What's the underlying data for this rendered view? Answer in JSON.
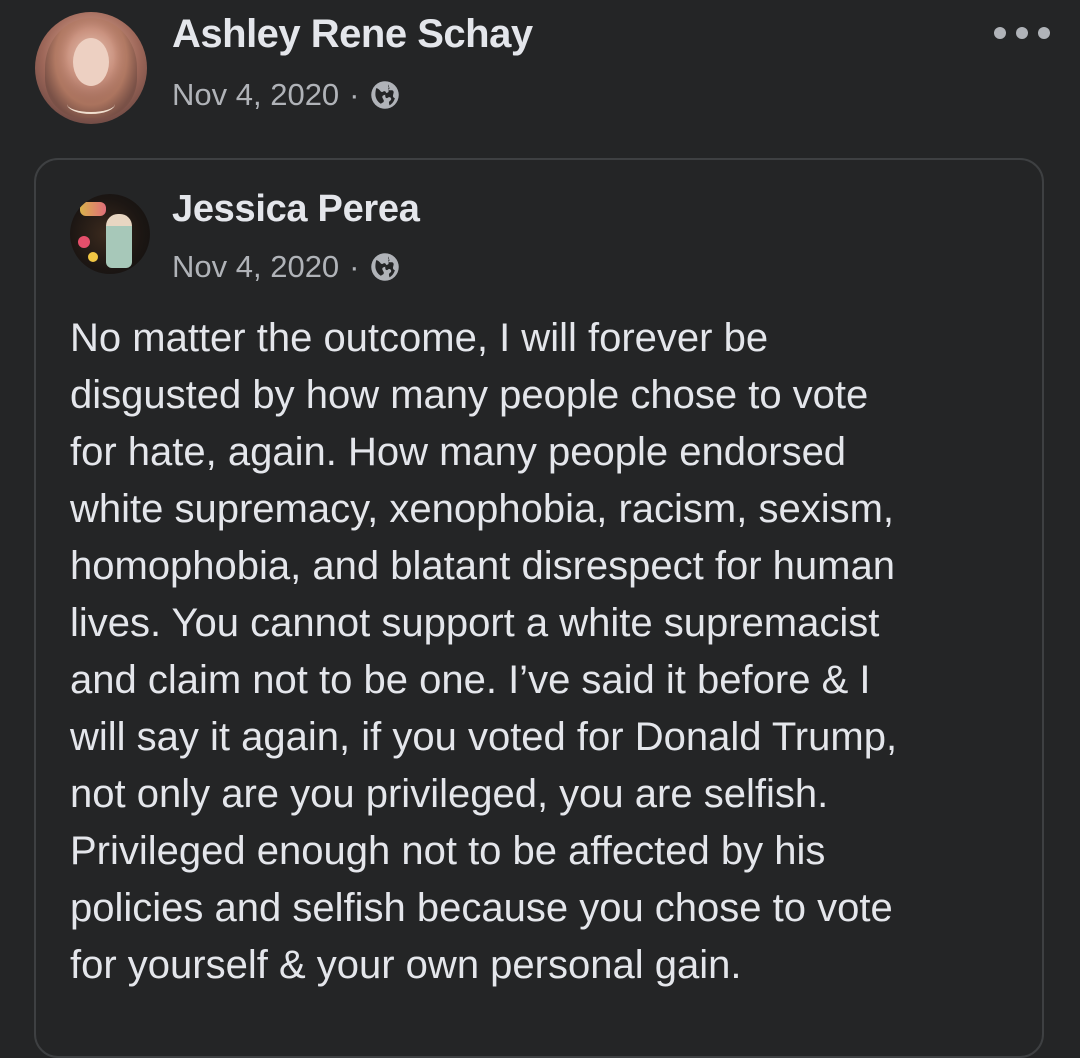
{
  "post": {
    "author": "Ashley Rene Schay",
    "date": "Nov 4, 2020",
    "separator": "·",
    "privacy_icon": "globe-icon",
    "more_icon": "more-options-icon"
  },
  "shared_post": {
    "author": "Jessica Perea",
    "date": "Nov 4, 2020",
    "separator": "·",
    "privacy_icon": "globe-icon",
    "lines": [
      "No matter the outcome, I will forever be",
      "disgusted by how many people chose to vote",
      "for hate, again. How many people endorsed",
      "white supremacy, xenophobia, racism, sexism,",
      "homophobia, and blatant disrespect for human",
      "lives. You cannot support a white supremacist",
      "and claim not to be one. I’ve said it before & I",
      "will say it again, if you voted for Donald Trump,",
      "not only are you privileged, you are selfish.",
      "Privileged enough not to be affected by his",
      "policies and selfish because you chose to vote",
      "for yourself & your own personal gain."
    ]
  },
  "colors": {
    "background": "#242526",
    "primary_text": "#e4e6eb",
    "secondary_text": "#b0b3b8",
    "card_border": "#3e4042"
  }
}
